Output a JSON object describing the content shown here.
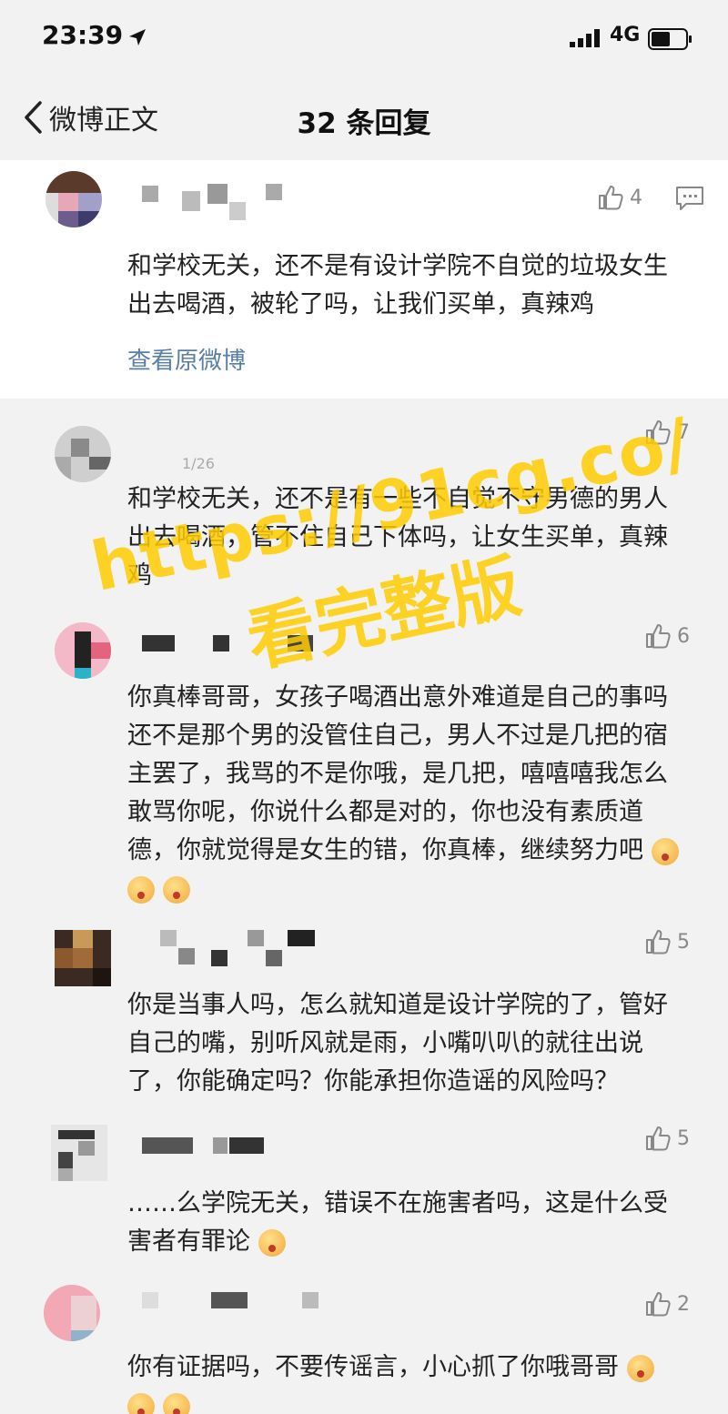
{
  "status_bar": {
    "time": "23:39",
    "network": "4G"
  },
  "nav": {
    "back_label": "微博正文",
    "title": "32 条回复"
  },
  "main_comment": {
    "likes": "4",
    "text": "和学校无关，还不是有设计学院不自觉的垃圾女生出去喝酒，被轮了吗，让我们买单，真辣鸡",
    "view_original": "查看原微博"
  },
  "replies": [
    {
      "likes": "7",
      "timestamp": "1/26",
      "text": "和学校无关，还不是有一些不自觉不守男德的男人出去喝酒，管不住自己下体吗，让女生买单，真辣鸡"
    },
    {
      "likes": "6",
      "text": "你真棒哥哥，女孩子喝酒出意外难道是自己的事吗还不是那个男的没管住自己，男人不过是几把的宿主罢了，我骂的不是你哦，是几把，嘻嘻嘻我怎么敢骂你呢，你说什么都是对的，你也没有素质道德，你就觉得是女生的错，你真棒，继续努力吧"
    },
    {
      "likes": "5",
      "text": "你是当事人吗，怎么就知道是设计学院的了，管好自己的嘴，别听风就是雨，小嘴叭叭的就往出说了，你能确定吗？你能承担你造谣的风险吗？"
    },
    {
      "likes": "5",
      "text": "……么学院无关，错误不在施害者吗，这是什么受害者有罪论"
    },
    {
      "likes": "2",
      "text": "你有证据吗，不要传谣言，小心抓了你哦哥哥"
    }
  ],
  "watermark": {
    "line1": "https://91cg.co/",
    "line2": "看完整版"
  },
  "colors": {
    "link": "#5a7fa6",
    "watermark": "#ffcd00"
  }
}
